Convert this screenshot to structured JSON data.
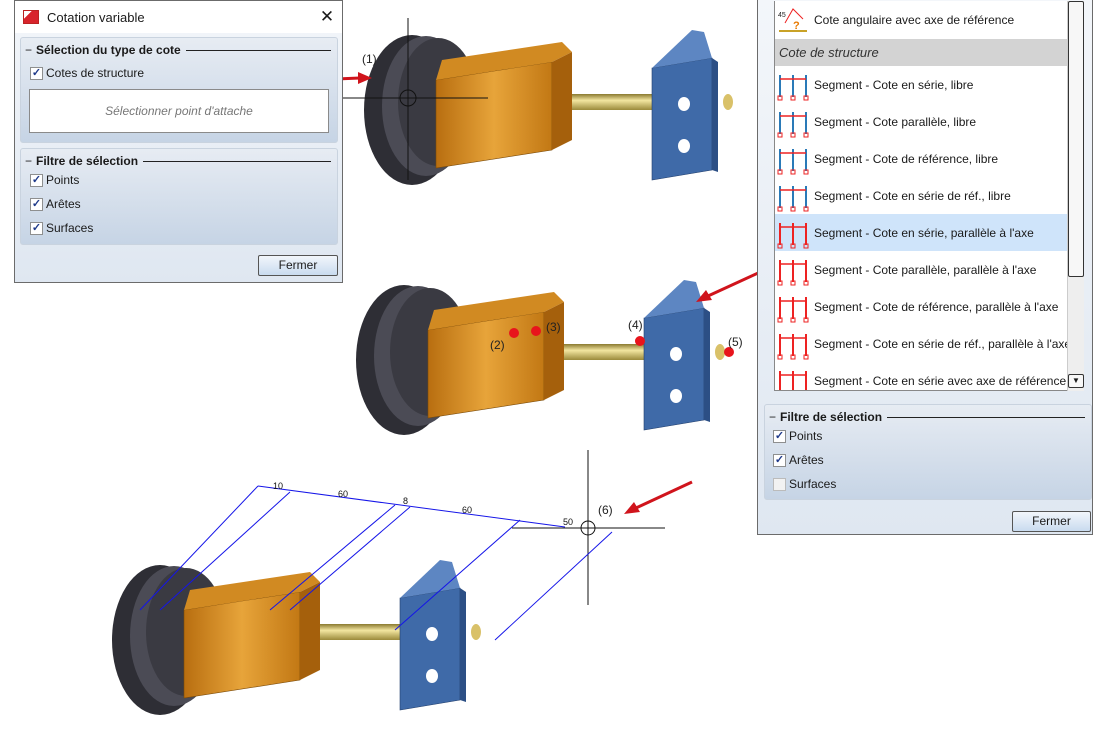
{
  "left_dialog": {
    "title": "Cotation variable",
    "close_icon": "close-icon",
    "type_group": {
      "title": "Sélection du type de cote",
      "checkbox": {
        "label": "Cotes de structure",
        "checked": true
      },
      "field_placeholder": "Sélectionner point d'attache"
    },
    "filter_group": {
      "title": "Filtre de sélection",
      "options": [
        {
          "label": "Points",
          "checked": true
        },
        {
          "label": "Arêtes",
          "checked": true
        },
        {
          "label": "Surfaces",
          "checked": true
        }
      ]
    },
    "close_button": "Fermer"
  },
  "right_panel": {
    "top_item": "Cote angulaire avec axe de référence",
    "section_header": "Cote de structure",
    "items": [
      {
        "label": "Segment - Cote en série, libre",
        "icon": "serial-free"
      },
      {
        "label": "Segment - Cote parallèle, libre",
        "icon": "parallel-free"
      },
      {
        "label": "Segment - Cote de référence, libre",
        "icon": "reference-free"
      },
      {
        "label": "Segment - Cote en série de réf., libre",
        "icon": "serial-ref-free"
      },
      {
        "label": "Segment - Cote en série, parallèle à l'axe",
        "icon": "serial-axis",
        "selected": true
      },
      {
        "label": "Segment - Cote parallèle, parallèle à l'axe",
        "icon": "parallel-axis"
      },
      {
        "label": "Segment - Cote de référence, parallèle à l'axe",
        "icon": "reference-axis"
      },
      {
        "label": "Segment - Cote en série de réf., parallèle à l'axe",
        "icon": "serial-ref-axis"
      },
      {
        "label": "Segment - Cote en série avec axe de référence",
        "icon": "serial-ref-line"
      }
    ],
    "filter_group": {
      "title": "Filtre de sélection",
      "options": [
        {
          "label": "Points",
          "checked": true
        },
        {
          "label": "Arêtes",
          "checked": true
        },
        {
          "label": "Surfaces",
          "checked": false
        }
      ]
    },
    "close_button": "Fermer"
  },
  "annotations": {
    "l1": "(1)",
    "l2": "(2)",
    "l3": "(3)",
    "l4": "(4)",
    "l5": "(5)",
    "l6": "(6)"
  },
  "dimensions": [
    "10",
    "60",
    "8",
    "60",
    "50"
  ],
  "colors": {
    "part_orange": "#e39a1e",
    "part_blue": "#3f6aa8",
    "wheel": "#3a3a42",
    "dimension": "#1515e8",
    "marker": "#e8141c"
  }
}
